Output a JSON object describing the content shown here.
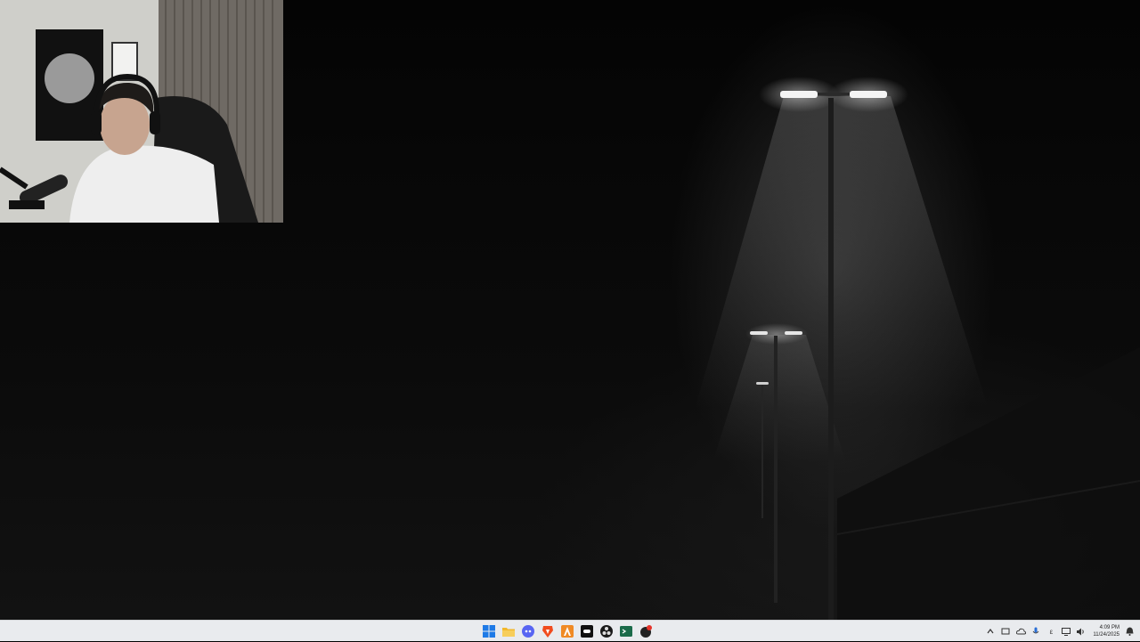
{
  "taskbar": {
    "pinned_apps": [
      {
        "name": "start",
        "color": "#1e7ae6"
      },
      {
        "name": "file-explorer",
        "color": "#f2b82c"
      },
      {
        "name": "discord",
        "color": "#5865f2"
      },
      {
        "name": "brave-browser",
        "color": "#f14c1e"
      },
      {
        "name": "apex-app",
        "color": "#f08a24"
      },
      {
        "name": "epic-games",
        "color": "#111111"
      },
      {
        "name": "obs-studio",
        "color": "#1a1a1a"
      },
      {
        "name": "terminal",
        "color": "#1b6b4a"
      },
      {
        "name": "game-app",
        "color": "#222222"
      }
    ],
    "tray": {
      "lang": "ε",
      "time": "4:09 PM",
      "date": "11/24/2025"
    }
  }
}
